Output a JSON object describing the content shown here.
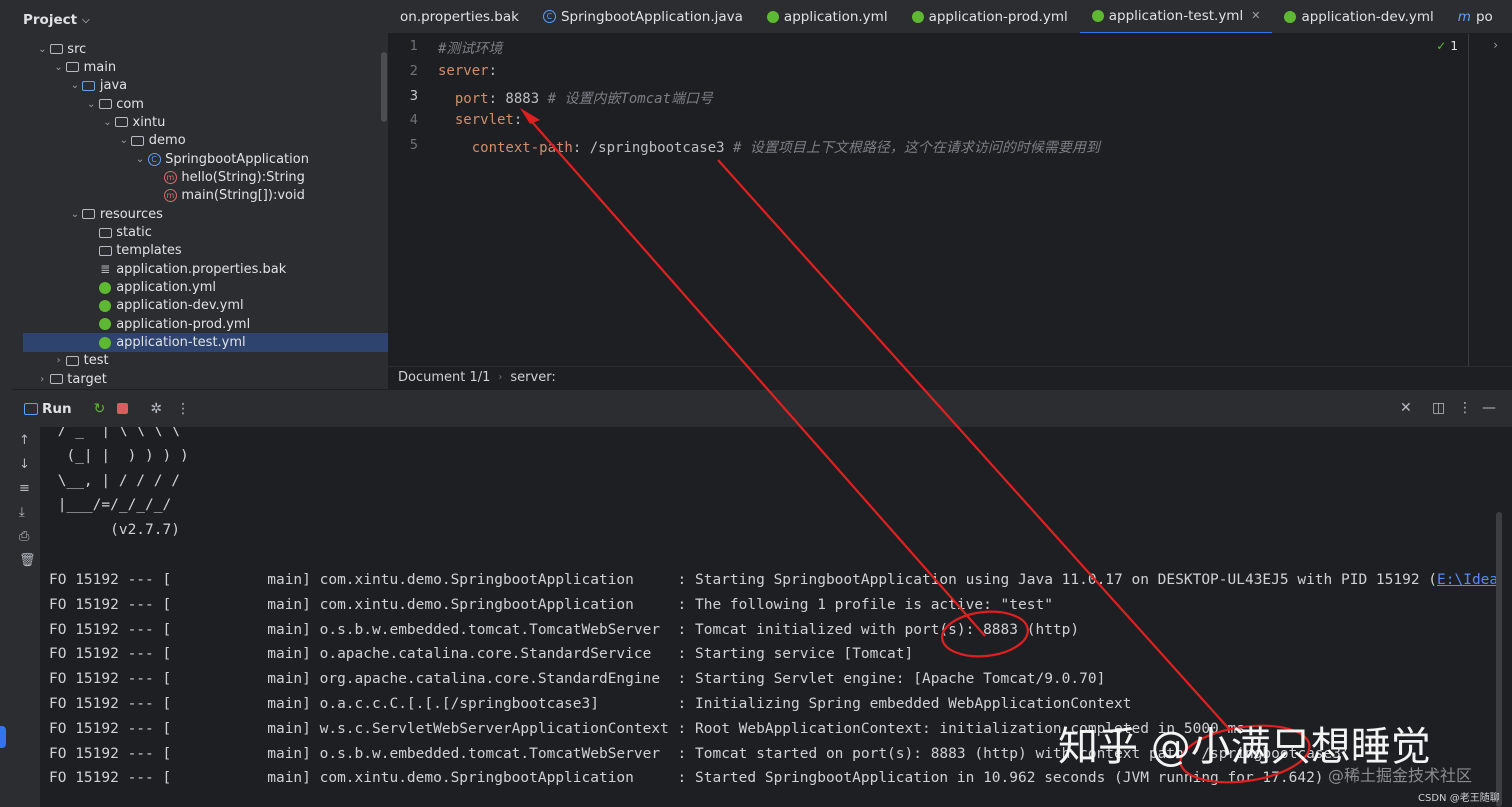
{
  "project": {
    "title": "Project",
    "tree": [
      {
        "label": "src",
        "depth": 1,
        "icon": "folder-icon",
        "chev": "down"
      },
      {
        "label": "main",
        "depth": 2,
        "icon": "folder-icon",
        "chev": "down"
      },
      {
        "label": "java",
        "depth": 3,
        "icon": "source-folder-icon",
        "chev": "down"
      },
      {
        "label": "com",
        "depth": 4,
        "icon": "package-icon",
        "chev": "down"
      },
      {
        "label": "xintu",
        "depth": 5,
        "icon": "package-icon",
        "chev": "down"
      },
      {
        "label": "demo",
        "depth": 6,
        "icon": "package-icon",
        "chev": "down"
      },
      {
        "label": "SpringbootApplication",
        "depth": 7,
        "icon": "class-icon",
        "chev": "down"
      },
      {
        "label": "hello(String):String",
        "depth": 8,
        "icon": "method-icon",
        "chev": ""
      },
      {
        "label": "main(String[]):void",
        "depth": 8,
        "icon": "method-icon",
        "chev": ""
      },
      {
        "label": "resources",
        "depth": 3,
        "icon": "resources-folder-icon",
        "chev": "down"
      },
      {
        "label": "static",
        "depth": 4,
        "icon": "folder-icon",
        "chev": ""
      },
      {
        "label": "templates",
        "depth": 4,
        "icon": "folder-icon",
        "chev": ""
      },
      {
        "label": "application.properties.bak",
        "depth": 4,
        "icon": "text-file-icon",
        "chev": ""
      },
      {
        "label": "application.yml",
        "depth": 4,
        "icon": "spring-icon",
        "chev": ""
      },
      {
        "label": "application-dev.yml",
        "depth": 4,
        "icon": "spring-icon",
        "chev": ""
      },
      {
        "label": "application-prod.yml",
        "depth": 4,
        "icon": "spring-icon",
        "chev": ""
      },
      {
        "label": "application-test.yml",
        "depth": 4,
        "icon": "spring-icon",
        "chev": "",
        "selected": true
      },
      {
        "label": "test",
        "depth": 2,
        "icon": "folder-icon",
        "chev": "right"
      },
      {
        "label": "target",
        "depth": 1,
        "icon": "folder-icon",
        "chev": "right"
      }
    ]
  },
  "tabs": [
    {
      "label": "on.properties.bak",
      "icon": ""
    },
    {
      "label": "SpringbootApplication.java",
      "icon": "class-icon"
    },
    {
      "label": "application.yml",
      "icon": "spring-icon"
    },
    {
      "label": "application-prod.yml",
      "icon": "spring-icon"
    },
    {
      "label": "application-test.yml",
      "icon": "spring-icon",
      "active": true
    },
    {
      "label": "application-dev.yml",
      "icon": "spring-icon"
    },
    {
      "label": "po",
      "icon": "m-icon"
    }
  ],
  "editor": {
    "inspection_count": "1",
    "lines": [
      {
        "n": "1",
        "parts": [
          {
            "t": "#测试环境",
            "c": "c"
          }
        ]
      },
      {
        "n": "2",
        "parts": [
          {
            "t": "server",
            "c": "k"
          },
          {
            "t": ":",
            "c": "v"
          }
        ]
      },
      {
        "n": "3",
        "parts": [
          {
            "t": "  port",
            "c": "k"
          },
          {
            "t": ": 8883 ",
            "c": "v"
          },
          {
            "t": "# 设置内嵌Tomcat端口号",
            "c": "c"
          }
        ]
      },
      {
        "n": "4",
        "parts": [
          {
            "t": "  servlet",
            "c": "k"
          },
          {
            "t": ":",
            "c": "v"
          }
        ]
      },
      {
        "n": "5",
        "parts": [
          {
            "t": "    context-path",
            "c": "k"
          },
          {
            "t": ": /springbootcase3 ",
            "c": "v"
          },
          {
            "t": "# 设置项目上下文根路径，这个在请求访问的时候需要用到",
            "c": "c"
          }
        ]
      }
    ]
  },
  "breadcrumb": {
    "doc": "Document 1/1",
    "path": "server:"
  },
  "run": {
    "title": "Run",
    "banner": [
      " / _` | \\ \\ \\ \\",
      "  (_| |  ) ) ) )",
      " \\__, | / / / /",
      " |___/=/_/_/_/",
      "       (v2.7.7)"
    ],
    "logs": [
      {
        "pre": "FO 15192 --- [           main] com.xintu.demo.SpringbootApplication     : Starting SpringbootApplication using Java 11.0.17 on DESKTOP-UL43EJ5 with PID 15192 (",
        "link": "E:\\IdeaProj"
      },
      {
        "pre": "FO 15192 --- [           main] com.xintu.demo.SpringbootApplication     : The following 1 profile is active: \"test\""
      },
      {
        "pre": "FO 15192 --- [           main] o.s.b.w.embedded.tomcat.TomcatWebServer  : Tomcat initialized with port(s): 8883 (http)"
      },
      {
        "pre": "FO 15192 --- [           main] o.apache.catalina.core.StandardService   : Starting service [Tomcat]"
      },
      {
        "pre": "FO 15192 --- [           main] org.apache.catalina.core.StandardEngine  : Starting Servlet engine: [Apache Tomcat/9.0.70]"
      },
      {
        "pre": "FO 15192 --- [           main] o.a.c.c.C.[.[.[/springbootcase3]         : Initializing Spring embedded WebApplicationContext"
      },
      {
        "pre": "FO 15192 --- [           main] w.s.c.ServletWebServerApplicationContext : Root WebApplicationContext: initialization completed in 5000 ms"
      },
      {
        "pre": "FO 15192 --- [           main] o.s.b.w.embedded.tomcat.TomcatWebServer  : Tomcat started on port(s): 8883 (http) with context path '/springbootcase3'"
      },
      {
        "pre": "FO 15192 --- [           main] com.xintu.demo.SpringbootApplication     : Started SpringbootApplication in 10.962 seconds (JVM running for 17.642)"
      }
    ]
  },
  "watermark": {
    "main": "知乎 @小满只想睡觉",
    "sub": "@稀土掘金技术社区",
    "csdn": "CSDN @老王随聊"
  },
  "colors": {
    "annotation": "#e02020",
    "accent": "#3574f0",
    "spring": "#5fb832"
  }
}
